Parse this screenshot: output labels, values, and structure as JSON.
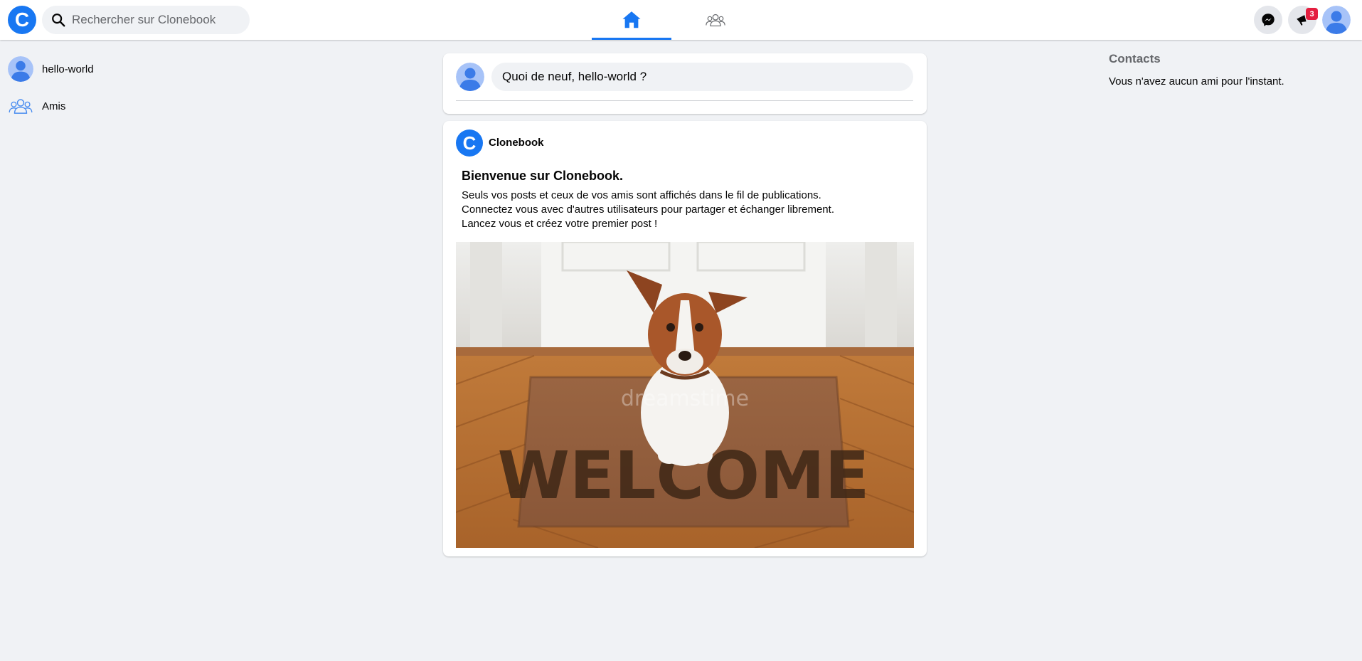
{
  "app": {
    "logo_letter": "C",
    "brand_color": "#1877f2"
  },
  "search": {
    "placeholder": "Rechercher sur Clonebook",
    "value": ""
  },
  "nav": {
    "tabs": [
      {
        "name": "home",
        "icon": "home-icon",
        "active": true
      },
      {
        "name": "friends",
        "icon": "friends-icon",
        "active": false
      }
    ]
  },
  "header_actions": {
    "messenger_icon": "messenger-icon",
    "notifications_icon": "megaphone-icon",
    "notifications_count": "3"
  },
  "sidebar": {
    "items": [
      {
        "label": "hello-world",
        "icon": "avatar"
      },
      {
        "label": "Amis",
        "icon": "friends-icon"
      }
    ]
  },
  "composer": {
    "placeholder": "Quoi de neuf, hello-world ?"
  },
  "post": {
    "author": "Clonebook",
    "author_initial": "C",
    "title": "Bienvenue sur Clonebook.",
    "lines": [
      "Seuls vos posts et ceux de vos amis sont affichés dans le fil de publications.",
      "Connectez vous avec d'autres utilisateurs pour partager et échanger librement.",
      "Lancez vous et créez votre premier post !"
    ],
    "image": {
      "mat_text": "WELCOME",
      "watermark": "dreamstime"
    }
  },
  "contacts": {
    "title": "Contacts",
    "empty_message": "Vous n'avez aucun ami pour l'instant."
  }
}
